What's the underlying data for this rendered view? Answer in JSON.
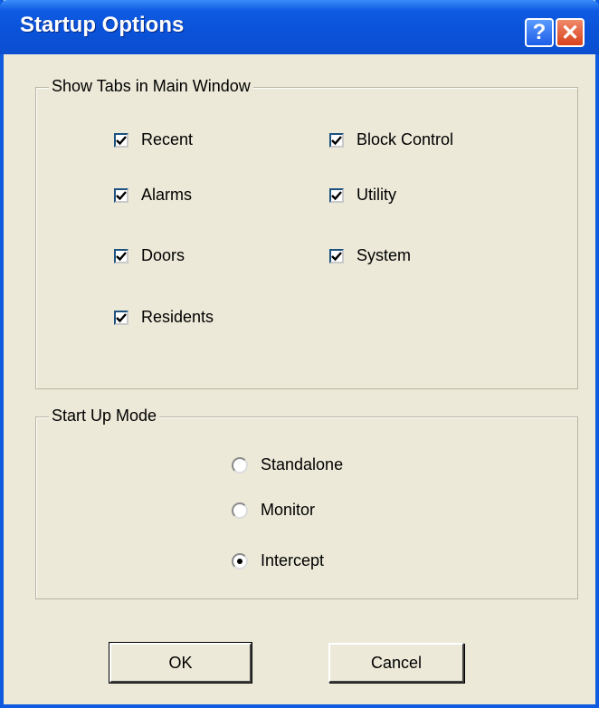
{
  "window": {
    "title": "Startup Options",
    "help_glyph": "?",
    "close_glyph": "✕"
  },
  "tabs_group": {
    "legend": "Show Tabs in Main Window",
    "items": [
      {
        "label": "Recent",
        "checked": true
      },
      {
        "label": "Alarms",
        "checked": true
      },
      {
        "label": "Doors",
        "checked": true
      },
      {
        "label": "Residents",
        "checked": true
      },
      {
        "label": "Block Control",
        "checked": true
      },
      {
        "label": "Utility",
        "checked": true
      },
      {
        "label": "System",
        "checked": true
      }
    ]
  },
  "mode_group": {
    "legend": "Start Up Mode",
    "options": [
      {
        "label": "Standalone",
        "selected": false
      },
      {
        "label": "Monitor",
        "selected": false
      },
      {
        "label": "Intercept",
        "selected": true
      }
    ]
  },
  "buttons": {
    "ok_label": "OK",
    "cancel_label": "Cancel"
  }
}
